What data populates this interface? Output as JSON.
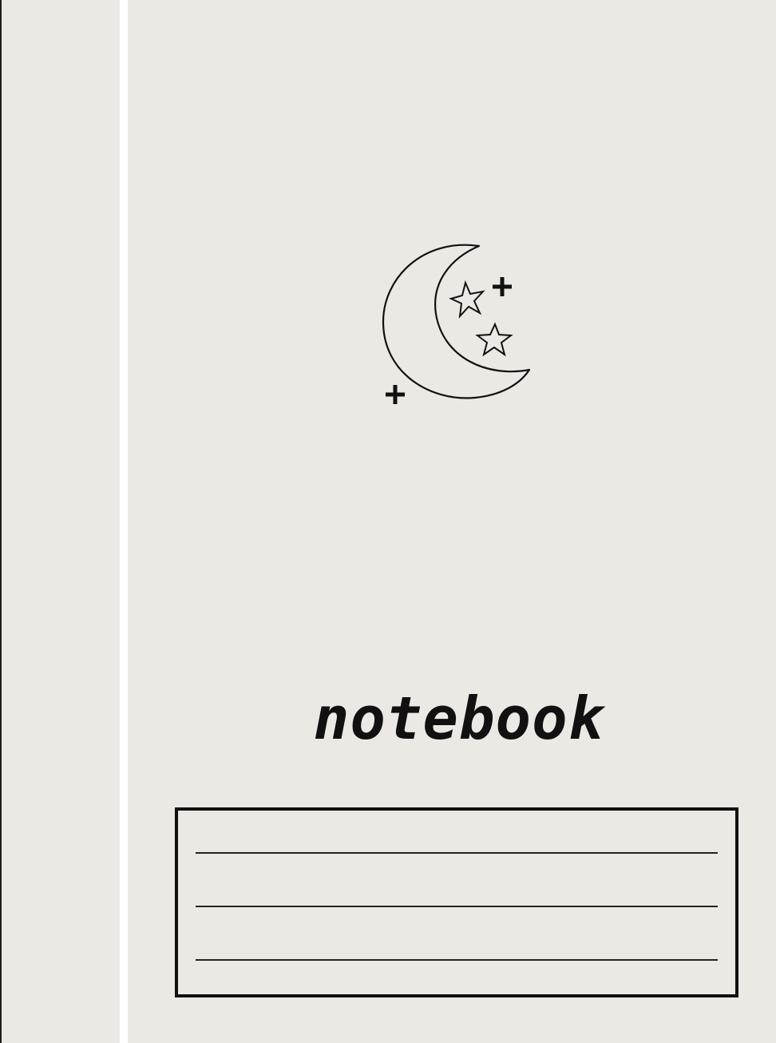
{
  "cover": {
    "title": "notebook",
    "background_color": "#ece9e4",
    "ink_color": "#111111",
    "spine_gap_color": "#ffffff"
  },
  "illustration": {
    "icon": "crescent-moon-with-stars-icon",
    "elements": [
      "crescent-moon",
      "outline-star",
      "outline-star",
      "plus-sparkle",
      "plus-sparkle"
    ]
  },
  "label_box": {
    "blank_lines": 3
  }
}
